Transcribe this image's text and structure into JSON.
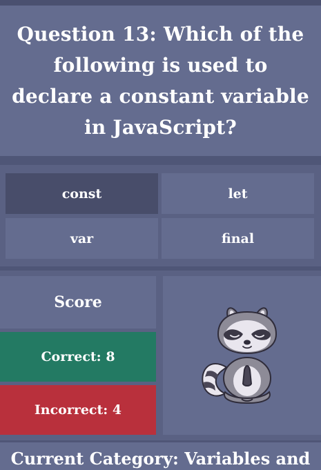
{
  "question": {
    "text": "Question 13: Which of the following is used to declare a constant variable in JavaScript?"
  },
  "answers": [
    {
      "label": "const",
      "selected": true
    },
    {
      "label": "let",
      "selected": false
    },
    {
      "label": "var",
      "selected": false
    },
    {
      "label": "final",
      "selected": false
    }
  ],
  "score": {
    "title": "Score",
    "correct_label": "Correct: 8",
    "incorrect_label": "Incorrect: 4"
  },
  "mascot": {
    "icon": "meditating-raccoon-icon"
  },
  "category": {
    "label": "Current Category: Variables and"
  },
  "colors": {
    "background": "#4f5677",
    "panel": "#646c8f",
    "selected_answer": "#484d6a",
    "correct": "#237a63",
    "incorrect": "#b9303c"
  }
}
